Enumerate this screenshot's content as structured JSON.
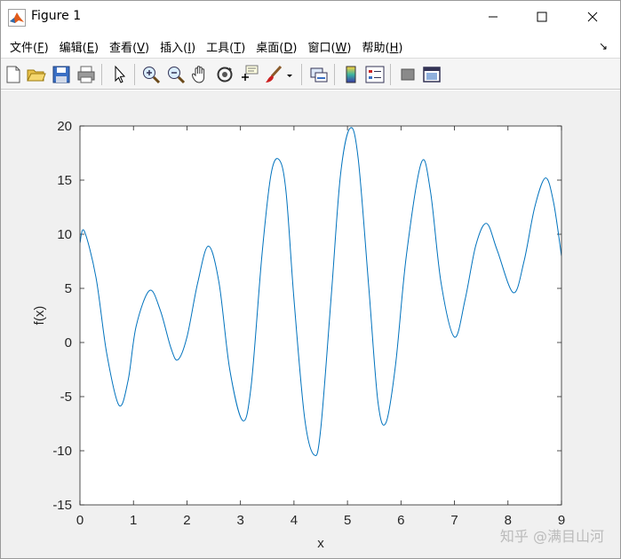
{
  "window": {
    "title": "Figure 1",
    "controls": {
      "minimize_icon": "minimize-icon",
      "maximize_icon": "maximize-icon",
      "close_icon": "close-icon"
    }
  },
  "menubar": {
    "items": [
      {
        "label": "文件",
        "key": "F"
      },
      {
        "label": "编辑",
        "key": "E"
      },
      {
        "label": "查看",
        "key": "V"
      },
      {
        "label": "插入",
        "key": "I"
      },
      {
        "label": "工具",
        "key": "T"
      },
      {
        "label": "桌面",
        "key": "D"
      },
      {
        "label": "窗口",
        "key": "W"
      },
      {
        "label": "帮助",
        "key": "H"
      }
    ],
    "dock_symbol": "↘"
  },
  "toolbar": {
    "items": [
      "new-figure-icon",
      "open-file-icon",
      "save-icon",
      "print-icon",
      "edit-plot-arrow-icon",
      "zoom-in-icon",
      "zoom-out-icon",
      "pan-hand-icon",
      "rotate-3d-icon",
      "data-cursor-icon",
      "brush-icon",
      "brush-dropdown-icon",
      "link-plot-icon",
      "insert-colorbar-icon",
      "insert-legend-icon",
      "hide-plot-tools-icon",
      "show-plot-tools-icon"
    ]
  },
  "colors": {
    "line": "#0072bd",
    "axes_bg": "#ffffff",
    "figure_bg": "#f0f0f0",
    "axis_color": "#262626"
  },
  "watermark": "知乎 @满目山河",
  "chart_data": {
    "type": "line",
    "xlabel": "x",
    "ylabel": "f(x)",
    "xlim": [
      0,
      9
    ],
    "ylim": [
      -15,
      20
    ],
    "xticks": [
      0,
      1,
      2,
      3,
      4,
      5,
      6,
      7,
      8,
      9
    ],
    "yticks": [
      -15,
      -10,
      -5,
      0,
      5,
      10,
      15,
      20
    ],
    "grid": false,
    "series": [
      {
        "x": [
          0,
          0.08,
          0.3,
          0.5,
          0.73,
          0.9,
          1.05,
          1.3,
          1.5,
          1.7,
          1.83,
          2.0,
          2.2,
          2.4,
          2.6,
          2.8,
          3.04,
          3.2,
          3.4,
          3.57,
          3.72,
          3.85,
          4.0,
          4.2,
          4.38,
          4.5,
          4.7,
          4.87,
          5.05,
          5.2,
          5.4,
          5.57,
          5.72,
          5.9,
          6.1,
          6.38,
          6.55,
          6.75,
          7.0,
          7.2,
          7.4,
          7.6,
          7.8,
          8.1,
          8.3,
          8.5,
          8.7,
          8.85,
          9.0
        ],
        "y": [
          9.2,
          10.3,
          6.0,
          -1.0,
          -5.8,
          -3.5,
          1.5,
          4.8,
          3.0,
          -0.5,
          -1.6,
          0.5,
          5.5,
          8.9,
          5.5,
          -2.5,
          -7.2,
          -4.0,
          8.0,
          15.5,
          16.9,
          14.0,
          4.0,
          -7.0,
          -10.4,
          -8.0,
          4.5,
          15.5,
          19.8,
          17.0,
          5.0,
          -5.5,
          -7.4,
          -2.0,
          8.0,
          16.6,
          14.0,
          5.5,
          0.5,
          4.0,
          9.0,
          11.0,
          8.5,
          4.6,
          7.5,
          12.5,
          15.2,
          13.0,
          8.0
        ]
      }
    ]
  }
}
